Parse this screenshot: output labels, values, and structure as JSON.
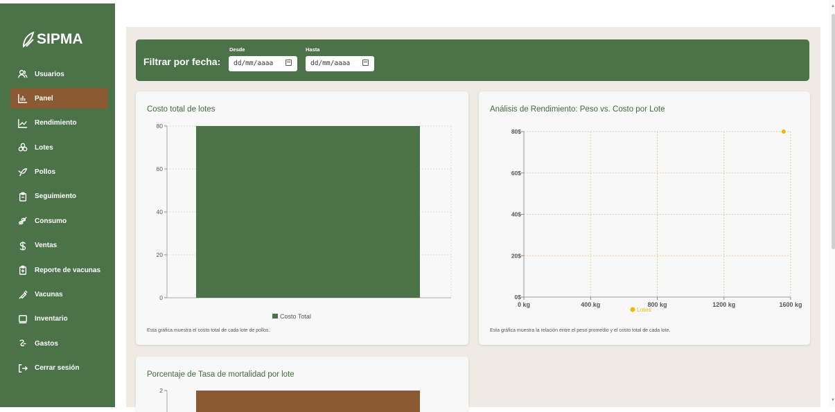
{
  "app": {
    "logo_text": "SIPMA"
  },
  "colors": {
    "sidebar": "#4b7249",
    "active": "#8b5a35",
    "bar_green": "#4b7249",
    "bar_brown": "#8b5a35",
    "scatter": "#f5b800"
  },
  "sidebar": {
    "items": [
      {
        "label": "Usuarios",
        "icon": "users-icon"
      },
      {
        "label": "Panel",
        "icon": "bar-chart-icon",
        "active": true
      },
      {
        "label": "Rendimiento",
        "icon": "line-chart-icon"
      },
      {
        "label": "Lotes",
        "icon": "cluster-icon"
      },
      {
        "label": "Pollos",
        "icon": "bird-icon"
      },
      {
        "label": "Seguimiento",
        "icon": "clipboard-icon"
      },
      {
        "label": "Consumo",
        "icon": "feed-icon"
      },
      {
        "label": "Ventas",
        "icon": "dollar-icon"
      },
      {
        "label": "Reporte de vacunas",
        "icon": "clipboard-plus-icon"
      },
      {
        "label": "Vacunas",
        "icon": "syringe-icon"
      },
      {
        "label": "Inventario",
        "icon": "inventory-icon"
      },
      {
        "label": "Gastos",
        "icon": "money-icon"
      },
      {
        "label": "Cerrar sesión",
        "icon": "logout-icon"
      }
    ]
  },
  "filter": {
    "title": "Filtrar por fecha:",
    "from_label": "Desde",
    "from_placeholder": "dd/mm/aaaa",
    "to_label": "Hasta",
    "to_placeholder": "dd/mm/aaaa"
  },
  "cards": {
    "cost": {
      "title": "Costo total de lotes",
      "description": "Esta gráfica muestra el costo total de cada lote de pollos."
    },
    "performance": {
      "title": "Análisis de Rendimiento: Peso vs. Costo por Lote",
      "description": "Esta gráfica muestra la relación entre el peso promedio y el costo total de cada lote."
    },
    "mortality": {
      "title": "Porcentaje de Tasa de mortalidad por lote"
    }
  },
  "chart_data": [
    {
      "type": "bar",
      "title": "Costo total de lotes",
      "categories": [
        ""
      ],
      "series": [
        {
          "name": "Costo Total",
          "values": [
            80
          ]
        }
      ],
      "yticks": [
        "0",
        "20",
        "40",
        "60",
        "80"
      ],
      "ylim": [
        0,
        80
      ],
      "legend": "bottom",
      "grid": true
    },
    {
      "type": "scatter",
      "title": "Análisis de Rendimiento: Peso vs. Costo por Lote",
      "series": [
        {
          "name": "Lotes",
          "points": [
            {
              "x": 1600,
              "y": 80
            }
          ]
        }
      ],
      "xticks": [
        "0 kg",
        "400 kg",
        "800 kg",
        "1200 kg",
        "1600 kg"
      ],
      "yticks": [
        "0$",
        "20$",
        "40$",
        "60$",
        "80$"
      ],
      "xlim": [
        0,
        1600
      ],
      "ylim": [
        0,
        80
      ],
      "legend": "bottom",
      "grid": true
    },
    {
      "type": "bar",
      "title": "Porcentaje de Tasa de mortalidad por lote",
      "categories": [
        ""
      ],
      "series": [
        {
          "values": [
            2
          ]
        }
      ],
      "yticks": [
        "2"
      ],
      "ylim": [
        0,
        2
      ]
    }
  ]
}
